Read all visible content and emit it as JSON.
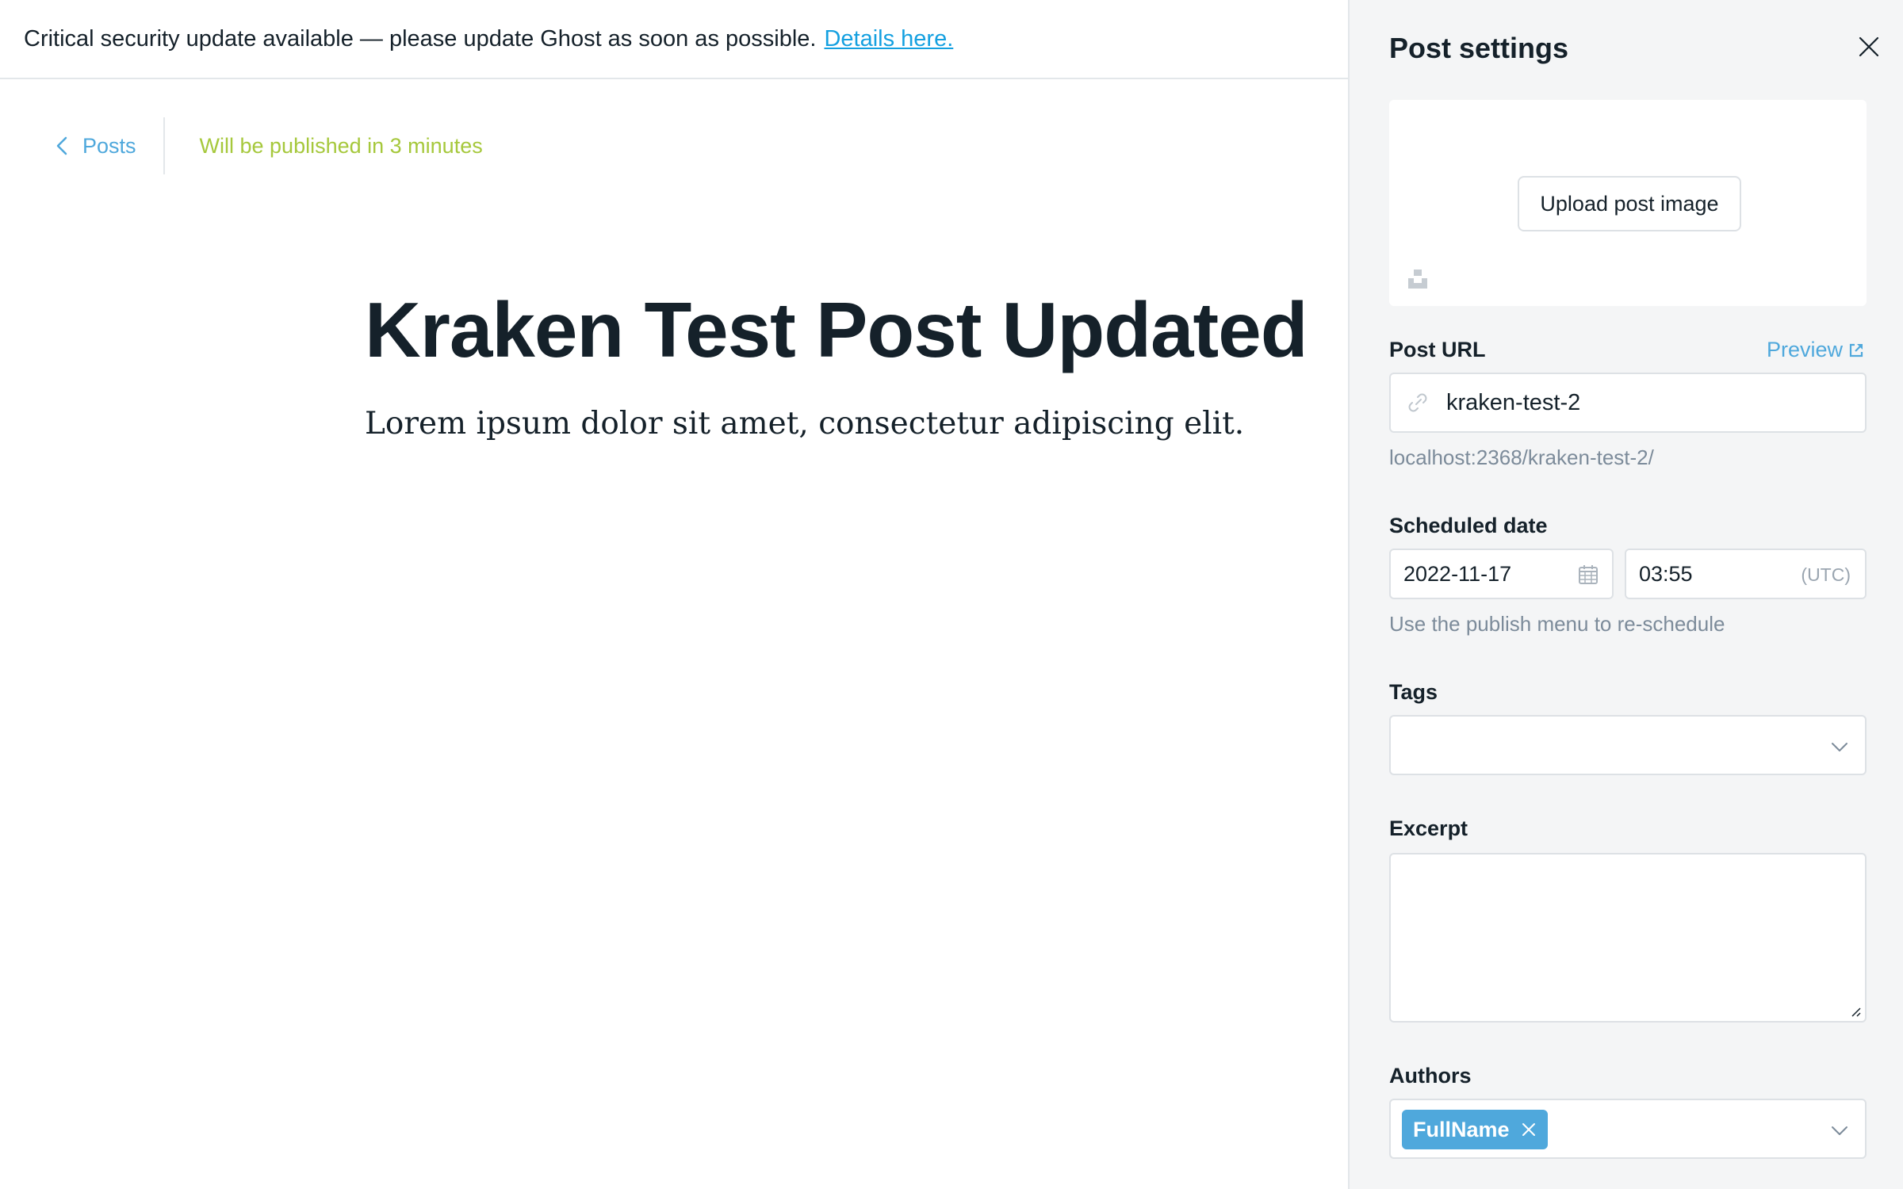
{
  "alert": {
    "message": "Critical security update available — please update Ghost as soon as possible.",
    "link_text": "Details here."
  },
  "editor": {
    "back_label": "Posts",
    "status": "Will be published in 3 minutes",
    "title": "Kraken Test Post Updated",
    "body": "Lorem ipsum dolor sit amet, consectetur adipiscing elit."
  },
  "settings": {
    "title": "Post settings",
    "upload_label": "Upload post image",
    "post_url": {
      "label": "Post URL",
      "preview_label": "Preview",
      "value": "kraken-test-2",
      "full_url": "localhost:2368/kraken-test-2/"
    },
    "scheduled": {
      "label": "Scheduled date",
      "date": "2022-11-17",
      "time": "03:55",
      "timezone": "(UTC)",
      "helper": "Use the publish menu to re-schedule"
    },
    "tags": {
      "label": "Tags",
      "value": ""
    },
    "excerpt": {
      "label": "Excerpt",
      "value": ""
    },
    "authors": {
      "label": "Authors",
      "items": [
        "FullName"
      ]
    }
  },
  "icons": {
    "back": "chevron-left-icon",
    "close": "close-icon",
    "unsplash": "unsplash-icon",
    "preview": "external-link-icon",
    "url": "link-icon",
    "calendar": "calendar-icon",
    "dropdown": "chevron-down-icon",
    "chip_remove": "close-icon"
  },
  "colors": {
    "accent": "#4fa8dc",
    "status_green": "#a6c83c",
    "panel_bg": "#f4f5f6",
    "text": "#15212a",
    "muted": "#7c8b9a"
  }
}
